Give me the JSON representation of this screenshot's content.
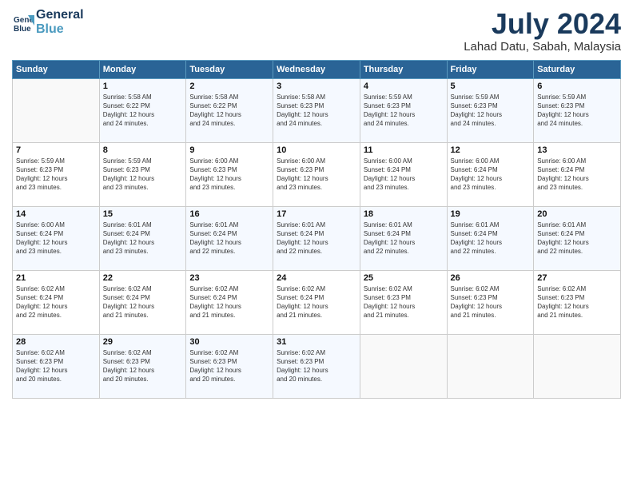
{
  "header": {
    "logo_line1": "General",
    "logo_line2": "Blue",
    "month": "July 2024",
    "location": "Lahad Datu, Sabah, Malaysia"
  },
  "weekdays": [
    "Sunday",
    "Monday",
    "Tuesday",
    "Wednesday",
    "Thursday",
    "Friday",
    "Saturday"
  ],
  "weeks": [
    [
      {
        "day": "",
        "info": ""
      },
      {
        "day": "1",
        "info": "Sunrise: 5:58 AM\nSunset: 6:22 PM\nDaylight: 12 hours\nand 24 minutes."
      },
      {
        "day": "2",
        "info": "Sunrise: 5:58 AM\nSunset: 6:22 PM\nDaylight: 12 hours\nand 24 minutes."
      },
      {
        "day": "3",
        "info": "Sunrise: 5:58 AM\nSunset: 6:23 PM\nDaylight: 12 hours\nand 24 minutes."
      },
      {
        "day": "4",
        "info": "Sunrise: 5:59 AM\nSunset: 6:23 PM\nDaylight: 12 hours\nand 24 minutes."
      },
      {
        "day": "5",
        "info": "Sunrise: 5:59 AM\nSunset: 6:23 PM\nDaylight: 12 hours\nand 24 minutes."
      },
      {
        "day": "6",
        "info": "Sunrise: 5:59 AM\nSunset: 6:23 PM\nDaylight: 12 hours\nand 24 minutes."
      }
    ],
    [
      {
        "day": "7",
        "info": "Sunrise: 5:59 AM\nSunset: 6:23 PM\nDaylight: 12 hours\nand 23 minutes."
      },
      {
        "day": "8",
        "info": "Sunrise: 5:59 AM\nSunset: 6:23 PM\nDaylight: 12 hours\nand 23 minutes."
      },
      {
        "day": "9",
        "info": "Sunrise: 6:00 AM\nSunset: 6:23 PM\nDaylight: 12 hours\nand 23 minutes."
      },
      {
        "day": "10",
        "info": "Sunrise: 6:00 AM\nSunset: 6:23 PM\nDaylight: 12 hours\nand 23 minutes."
      },
      {
        "day": "11",
        "info": "Sunrise: 6:00 AM\nSunset: 6:24 PM\nDaylight: 12 hours\nand 23 minutes."
      },
      {
        "day": "12",
        "info": "Sunrise: 6:00 AM\nSunset: 6:24 PM\nDaylight: 12 hours\nand 23 minutes."
      },
      {
        "day": "13",
        "info": "Sunrise: 6:00 AM\nSunset: 6:24 PM\nDaylight: 12 hours\nand 23 minutes."
      }
    ],
    [
      {
        "day": "14",
        "info": "Sunrise: 6:00 AM\nSunset: 6:24 PM\nDaylight: 12 hours\nand 23 minutes."
      },
      {
        "day": "15",
        "info": "Sunrise: 6:01 AM\nSunset: 6:24 PM\nDaylight: 12 hours\nand 23 minutes."
      },
      {
        "day": "16",
        "info": "Sunrise: 6:01 AM\nSunset: 6:24 PM\nDaylight: 12 hours\nand 22 minutes."
      },
      {
        "day": "17",
        "info": "Sunrise: 6:01 AM\nSunset: 6:24 PM\nDaylight: 12 hours\nand 22 minutes."
      },
      {
        "day": "18",
        "info": "Sunrise: 6:01 AM\nSunset: 6:24 PM\nDaylight: 12 hours\nand 22 minutes."
      },
      {
        "day": "19",
        "info": "Sunrise: 6:01 AM\nSunset: 6:24 PM\nDaylight: 12 hours\nand 22 minutes."
      },
      {
        "day": "20",
        "info": "Sunrise: 6:01 AM\nSunset: 6:24 PM\nDaylight: 12 hours\nand 22 minutes."
      }
    ],
    [
      {
        "day": "21",
        "info": "Sunrise: 6:02 AM\nSunset: 6:24 PM\nDaylight: 12 hours\nand 22 minutes."
      },
      {
        "day": "22",
        "info": "Sunrise: 6:02 AM\nSunset: 6:24 PM\nDaylight: 12 hours\nand 21 minutes."
      },
      {
        "day": "23",
        "info": "Sunrise: 6:02 AM\nSunset: 6:24 PM\nDaylight: 12 hours\nand 21 minutes."
      },
      {
        "day": "24",
        "info": "Sunrise: 6:02 AM\nSunset: 6:24 PM\nDaylight: 12 hours\nand 21 minutes."
      },
      {
        "day": "25",
        "info": "Sunrise: 6:02 AM\nSunset: 6:23 PM\nDaylight: 12 hours\nand 21 minutes."
      },
      {
        "day": "26",
        "info": "Sunrise: 6:02 AM\nSunset: 6:23 PM\nDaylight: 12 hours\nand 21 minutes."
      },
      {
        "day": "27",
        "info": "Sunrise: 6:02 AM\nSunset: 6:23 PM\nDaylight: 12 hours\nand 21 minutes."
      }
    ],
    [
      {
        "day": "28",
        "info": "Sunrise: 6:02 AM\nSunset: 6:23 PM\nDaylight: 12 hours\nand 20 minutes."
      },
      {
        "day": "29",
        "info": "Sunrise: 6:02 AM\nSunset: 6:23 PM\nDaylight: 12 hours\nand 20 minutes."
      },
      {
        "day": "30",
        "info": "Sunrise: 6:02 AM\nSunset: 6:23 PM\nDaylight: 12 hours\nand 20 minutes."
      },
      {
        "day": "31",
        "info": "Sunrise: 6:02 AM\nSunset: 6:23 PM\nDaylight: 12 hours\nand 20 minutes."
      },
      {
        "day": "",
        "info": ""
      },
      {
        "day": "",
        "info": ""
      },
      {
        "day": "",
        "info": ""
      }
    ]
  ]
}
